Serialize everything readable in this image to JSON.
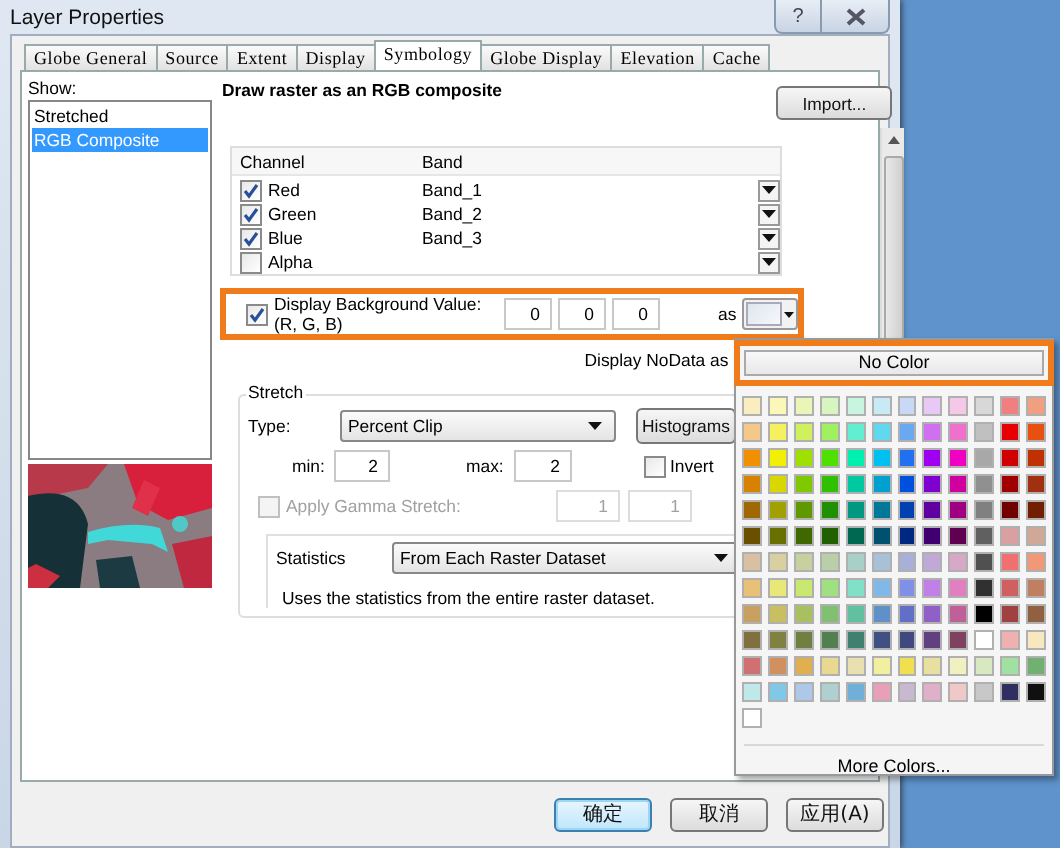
{
  "window": {
    "title": "Layer Properties",
    "help_button": "?"
  },
  "tabs": [
    {
      "label": "Globe General",
      "selected": false
    },
    {
      "label": "Source",
      "selected": false
    },
    {
      "label": "Extent",
      "selected": false
    },
    {
      "label": "Display",
      "selected": false
    },
    {
      "label": "Symbology",
      "selected": true
    },
    {
      "label": "Globe Display",
      "selected": false
    },
    {
      "label": "Elevation",
      "selected": false
    },
    {
      "label": "Cache",
      "selected": false
    }
  ],
  "show": {
    "label": "Show:",
    "items": [
      {
        "label": "Stretched",
        "selected": false
      },
      {
        "label": "RGB Composite",
        "selected": true
      }
    ]
  },
  "heading": "Draw raster as an RGB composite",
  "import_button": "Import...",
  "band_table": {
    "columns": [
      "Channel",
      "Band"
    ],
    "rows": [
      {
        "channel": "Red",
        "checked": true,
        "band": "Band_1"
      },
      {
        "channel": "Green",
        "checked": true,
        "band": "Band_2"
      },
      {
        "channel": "Blue",
        "checked": true,
        "band": "Band_3"
      },
      {
        "channel": "Alpha",
        "checked": false
      }
    ]
  },
  "background_value": {
    "checked": true,
    "label": "Display Background Value:(R, G, B)",
    "values": [
      "0",
      "0",
      "0"
    ],
    "as_label": "as"
  },
  "nodata_label": "Display NoData as",
  "stretch": {
    "title": "Stretch",
    "type_label": "Type:",
    "type_value": "Percent Clip",
    "histograms_button": "Histograms",
    "min_label": "min:",
    "min": "2",
    "max_label": "max:",
    "max": "2",
    "invert": {
      "label": "Invert",
      "checked": false
    },
    "gamma": {
      "label": "Apply Gamma Stretch:",
      "checked": false,
      "disabled": true,
      "values": [
        "1",
        "1"
      ]
    }
  },
  "statistics": {
    "label": "Statistics",
    "value": "From Each Raster Dataset",
    "description": "Uses the statistics from the entire raster dataset."
  },
  "color_menu": {
    "no_color": "No Color",
    "more_colors": "More Colors...",
    "rows": [
      {
        "swatches": [
          {
            "color": "#f8eec0"
          },
          {
            "color": "#fbf7b8"
          },
          {
            "color": "#eaf5b8"
          },
          {
            "color": "#d8f5c0"
          },
          {
            "color": "#c8f5e0"
          },
          {
            "color": "#c8eaf5"
          },
          {
            "color": "#c8d8f5"
          },
          {
            "color": "#e8c8f5"
          },
          {
            "color": "#f5c8e8"
          },
          {
            "color": "#d8d8d8"
          },
          {
            "color": "#f08080"
          },
          {
            "color": "#f0a080"
          }
        ]
      },
      {
        "swatches": [
          {
            "color": "#f5c888"
          },
          {
            "color": "#f5f060"
          },
          {
            "color": "#d0f060"
          },
          {
            "color": "#a0f060"
          },
          {
            "color": "#60f0d0"
          },
          {
            "color": "#60d8f0"
          },
          {
            "color": "#6aa8f0"
          },
          {
            "color": "#d070f0"
          },
          {
            "color": "#f070d0"
          },
          {
            "color": "#c0c0c0"
          },
          {
            "color": "#e80000"
          },
          {
            "color": "#e85010"
          }
        ]
      },
      {
        "swatches": [
          {
            "color": "#f09000"
          },
          {
            "color": "#f0f000"
          },
          {
            "color": "#a0e000"
          },
          {
            "color": "#50e000"
          },
          {
            "color": "#00f0b0"
          },
          {
            "color": "#00c0f0"
          },
          {
            "color": "#2070f0"
          },
          {
            "color": "#a000f0"
          },
          {
            "color": "#f000c0"
          },
          {
            "color": "#a8a8a8"
          },
          {
            "color": "#d00000"
          },
          {
            "color": "#c03000"
          }
        ]
      },
      {
        "swatches": [
          {
            "color": "#d88000"
          },
          {
            "color": "#d8d800"
          },
          {
            "color": "#80c800"
          },
          {
            "color": "#30c000"
          },
          {
            "color": "#00c8a0"
          },
          {
            "color": "#00a0d0"
          },
          {
            "color": "#0050e0"
          },
          {
            "color": "#8000d0"
          },
          {
            "color": "#d000a0"
          },
          {
            "color": "#909090"
          },
          {
            "color": "#a00000"
          },
          {
            "color": "#a03010"
          }
        ]
      },
      {
        "swatches": [
          {
            "color": "#a06800"
          },
          {
            "color": "#a0a000"
          },
          {
            "color": "#609800"
          },
          {
            "color": "#209000"
          },
          {
            "color": "#009880"
          },
          {
            "color": "#007898"
          },
          {
            "color": "#0040b0"
          },
          {
            "color": "#6000a0"
          },
          {
            "color": "#a00080"
          },
          {
            "color": "#808080"
          },
          {
            "color": "#700000"
          },
          {
            "color": "#702000"
          }
        ]
      },
      {
        "swatches": [
          {
            "color": "#685000"
          },
          {
            "color": "#687000"
          },
          {
            "color": "#406800"
          },
          {
            "color": "#206000"
          },
          {
            "color": "#006850"
          },
          {
            "color": "#005070"
          },
          {
            "color": "#002880"
          },
          {
            "color": "#400070"
          },
          {
            "color": "#600050"
          },
          {
            "color": "#606060"
          },
          {
            "color": "#d8a0a0"
          },
          {
            "color": "#d0a898"
          }
        ]
      },
      {
        "swatches": [
          {
            "color": "#d8c0a0"
          },
          {
            "color": "#d8d0a0"
          },
          {
            "color": "#c8d0a0"
          },
          {
            "color": "#b8d0a8"
          },
          {
            "color": "#a8d0c8"
          },
          {
            "color": "#a8c0d8"
          },
          {
            "color": "#a8b0d8"
          },
          {
            "color": "#c0a8d8"
          },
          {
            "color": "#d8a8c8"
          },
          {
            "color": "#505050"
          },
          {
            "color": "#f07070"
          },
          {
            "color": "#f09878"
          }
        ]
      },
      {
        "swatches": [
          {
            "color": "#e8c078"
          },
          {
            "color": "#e8e878"
          },
          {
            "color": "#c8e870"
          },
          {
            "color": "#a0e080"
          },
          {
            "color": "#80e0c8"
          },
          {
            "color": "#80b8e8"
          },
          {
            "color": "#8090e8"
          },
          {
            "color": "#c080e8"
          },
          {
            "color": "#e080c0"
          },
          {
            "color": "#303030"
          },
          {
            "color": "#d06060"
          },
          {
            "color": "#c08060"
          }
        ]
      },
      {
        "swatches": [
          {
            "color": "#c8a060"
          },
          {
            "color": "#c8c060"
          },
          {
            "color": "#a8c060"
          },
          {
            "color": "#80c070"
          },
          {
            "color": "#60c0a0"
          },
          {
            "color": "#6090c8"
          },
          {
            "color": "#6070c8"
          },
          {
            "color": "#9060c8"
          },
          {
            "color": "#c06098"
          },
          {
            "color": "#000000"
          },
          {
            "color": "#a04040"
          },
          {
            "color": "#906040"
          }
        ]
      },
      {
        "swatches": [
          {
            "color": "#807040"
          },
          {
            "color": "#808040"
          },
          {
            "color": "#708040"
          },
          {
            "color": "#508050"
          },
          {
            "color": "#408070"
          },
          {
            "color": "#405080"
          },
          {
            "color": "#404880"
          },
          {
            "color": "#604080"
          },
          {
            "color": "#804060"
          },
          {
            "color": "#ffffff"
          },
          {
            "color": "#f0b0b0"
          },
          {
            "color": "#f8e8c0"
          }
        ]
      },
      {
        "swatches": [
          {
            "color": "#d07070"
          },
          {
            "color": "#d09060"
          },
          {
            "color": "#e0b050"
          },
          {
            "color": "#e8d890"
          },
          {
            "color": "#e8e0b0"
          },
          {
            "color": "#f0f0a0"
          },
          {
            "color": "#f0e050"
          },
          {
            "color": "#e8e0a0"
          },
          {
            "color": "#f0f0c0"
          },
          {
            "color": "#d8e8c0"
          },
          {
            "color": "#a0e0a0"
          },
          {
            "color": "#70b070"
          }
        ]
      },
      {
        "swatches": [
          {
            "color": "#c0e8e8"
          },
          {
            "color": "#80c8e8"
          },
          {
            "color": "#b0c8e8"
          },
          {
            "color": "#b0d0d0"
          },
          {
            "color": "#70b0d8"
          },
          {
            "color": "#e8a0b8"
          },
          {
            "color": "#c8b8d0"
          },
          {
            "color": "#e0b0c8"
          },
          {
            "color": "#f0c8c8"
          },
          {
            "color": "#c8c8c8"
          },
          {
            "color": "#303060"
          },
          {
            "color": "#101010"
          }
        ]
      },
      {
        "swatches": [
          {
            "color": "#ffffff"
          }
        ]
      }
    ]
  },
  "buttons": [
    {
      "label": "确定",
      "default": true
    },
    {
      "label": "取消",
      "default": false
    },
    {
      "label": "应用(A)",
      "default": false
    }
  ]
}
